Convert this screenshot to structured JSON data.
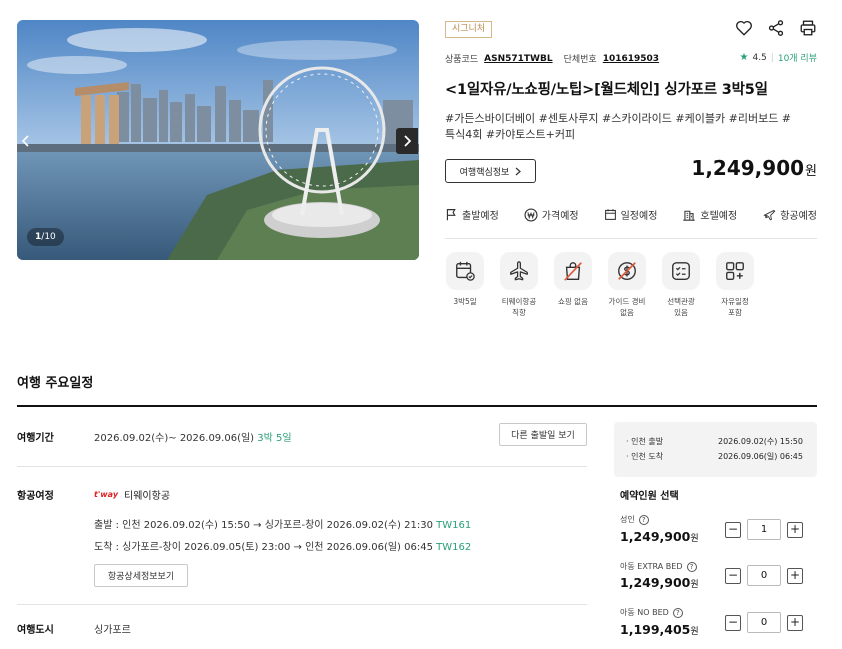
{
  "gallery": {
    "current": "1",
    "total": "10",
    "sep": "/"
  },
  "badge": "시그니처",
  "codes": {
    "product_code_label": "상품코드",
    "product_code": "ASN571TWBL",
    "group_no_label": "단체번호",
    "group_no": "101619503"
  },
  "rating": {
    "score": "4.5",
    "sep": "|",
    "reviews": "10개 리뷰"
  },
  "title": "<1일자유/노쇼핑/노팁>[월드체인] 싱가포르 3박5일",
  "tags": "#가든스바이더베이 #센토사루지 #스카이라이드 #케이블카 #리버보드 #특식4회 #카야토스트+커피",
  "info_button": "여행핵심정보",
  "price": {
    "amount": "1,249,900",
    "unit": "원"
  },
  "status_items": [
    {
      "label": "출발예정",
      "icon": "flag-icon"
    },
    {
      "label": "가격예정",
      "icon": "won-circle-icon"
    },
    {
      "label": "일정예정",
      "icon": "calendar-icon"
    },
    {
      "label": "호텔예정",
      "icon": "hotel-icon"
    },
    {
      "label": "항공예정",
      "icon": "plane-icon"
    }
  ],
  "features": [
    {
      "line1": "3박5일",
      "line2": "",
      "icon": "calendar-check-icon"
    },
    {
      "line1": "티웨이항공",
      "line2": "직항",
      "icon": "airplane-icon"
    },
    {
      "line1": "쇼핑 없음",
      "line2": "",
      "icon": "no-shopping-icon"
    },
    {
      "line1": "가이드 경비",
      "line2": "없음",
      "icon": "no-guide-fee-icon"
    },
    {
      "line1": "선택관광",
      "line2": "있음",
      "icon": "checklist-icon"
    },
    {
      "line1": "자유일정",
      "line2": "포함",
      "icon": "grid-plus-icon"
    }
  ],
  "schedule": {
    "section_title": "여행 주요일정",
    "period_label": "여행기간",
    "period_text": "2026.09.02(수)~ 2026.09.06(일)",
    "period_nights": "3박 5일",
    "other_dates_button": "다른 출발일 보기",
    "flight_label": "항공여정",
    "airline_logo": "t'way",
    "airline_name": "티웨이항공",
    "depart_text": "출발 : 인천 2026.09.02(수) 15:50 → 싱가포르-창이 2026.09.02(수) 21:30",
    "depart_flight": "TW161",
    "arrive_text": "도착 : 싱가포르-창이 2026.09.05(토) 23:00 → 인천 2026.09.06(일) 06:45",
    "arrive_flight": "TW162",
    "flight_detail_button": "항공상세정보보기",
    "city_label": "여행도시",
    "city": "싱가포르"
  },
  "summary": {
    "depart_label": "· 인천 출발",
    "depart_value": "2026.09.02(수) 15:50",
    "arrive_label": "· 인천 도착",
    "arrive_value": "2026.09.06(일) 06:45"
  },
  "reservation": {
    "title": "예약인원 선택",
    "pax": [
      {
        "label": "성인",
        "price": "1,249,900",
        "unit": "원",
        "count": "1"
      },
      {
        "label": "아동 EXTRA BED",
        "price": "1,249,900",
        "unit": "원",
        "count": "0"
      },
      {
        "label": "아동 NO BED",
        "price": "1,199,405",
        "unit": "원",
        "count": "0"
      }
    ],
    "minus": "−",
    "plus": "+",
    "help": "?"
  },
  "colors": {
    "accent_green": "#2aa079",
    "badge_gold": "#b88a4d",
    "airline_red": "#dd2222"
  }
}
